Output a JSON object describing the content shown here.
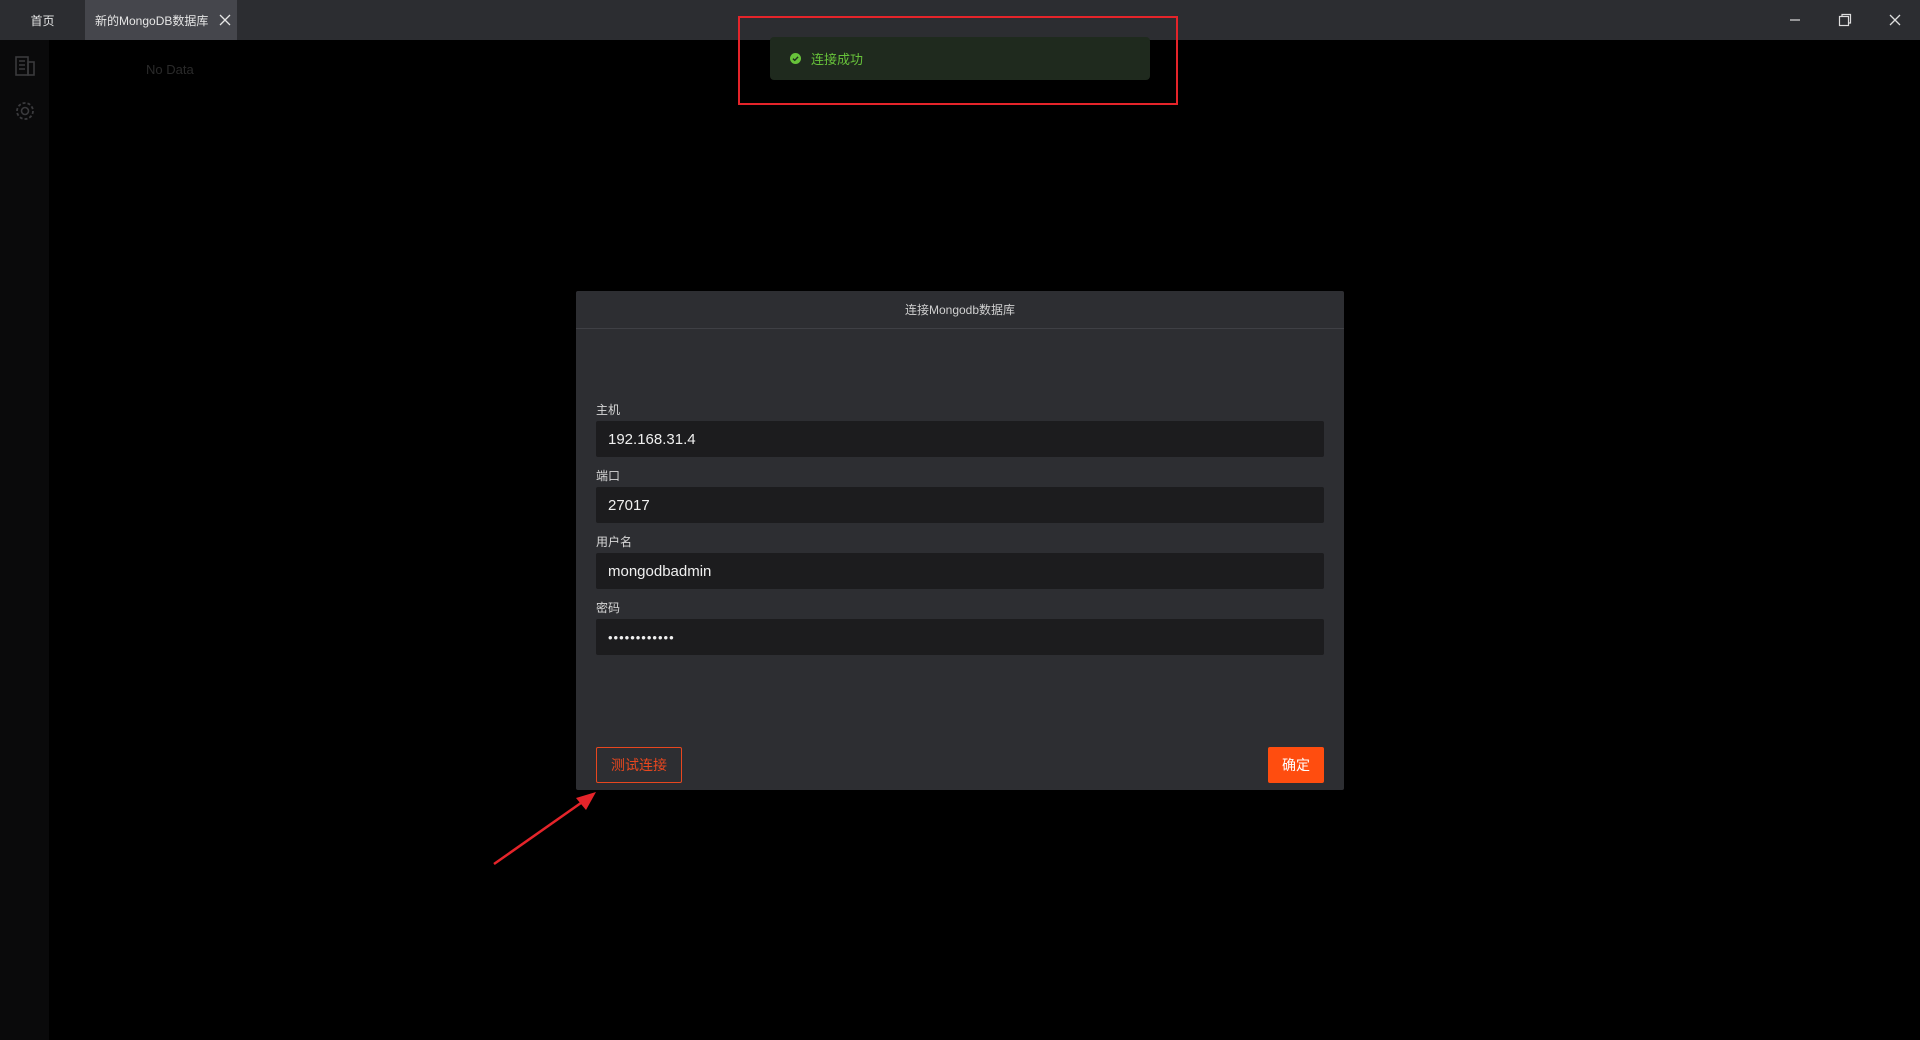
{
  "tabs": [
    {
      "label": "首页"
    },
    {
      "label": "新的MongoDB数据库"
    }
  ],
  "main": {
    "empty_text": "No Data"
  },
  "toast": {
    "message": "连接成功",
    "color": "#67c23a"
  },
  "dialog": {
    "title": "连接Mongodb数据库",
    "fields": [
      {
        "label": "主机",
        "value": "192.168.31.4"
      },
      {
        "label": "端口",
        "value": "27017"
      },
      {
        "label": "用户名",
        "value": "mongodbadmin"
      },
      {
        "label": "密码",
        "value": "••••••••••••"
      }
    ],
    "test_button": "测试连接",
    "confirm_button": "确定"
  },
  "colors": {
    "accent": "#ff4d0f",
    "success": "#67c23a",
    "highlight": "#e5242a"
  },
  "icons": [
    "close-icon",
    "minimize-icon",
    "maximize-icon",
    "database-icon",
    "settings-icon",
    "check-circle-icon"
  ]
}
